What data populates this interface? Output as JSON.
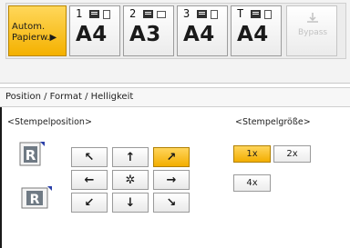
{
  "paper_select": {
    "auto_button": {
      "line1": "Autom.",
      "line2": "Papierw.▶"
    },
    "trays": [
      {
        "number": "1",
        "size": "A4"
      },
      {
        "number": "2",
        "size": "A3"
      },
      {
        "number": "3",
        "size": "A4"
      },
      {
        "number": "T",
        "size": "A4"
      }
    ],
    "bypass": {
      "label": "Bypass",
      "icon": "bypass-tray-icon"
    }
  },
  "breadcrumb": "Position / Format / Helligkeit",
  "stamp_position": {
    "label": "<Stempelposition>",
    "buttons": [
      {
        "id": "top-left",
        "glyph": "↖",
        "selected": false
      },
      {
        "id": "top-center",
        "glyph": "↑",
        "selected": false
      },
      {
        "id": "top-right",
        "glyph": "↗",
        "selected": true
      },
      {
        "id": "middle-left",
        "glyph": "←",
        "selected": false
      },
      {
        "id": "center",
        "glyph": "✲",
        "selected": false
      },
      {
        "id": "middle-right",
        "glyph": "→",
        "selected": false
      },
      {
        "id": "bottom-left",
        "glyph": "↙",
        "selected": false
      },
      {
        "id": "bottom-center",
        "glyph": "↓",
        "selected": false
      },
      {
        "id": "bottom-right",
        "glyph": "↘",
        "selected": false
      }
    ]
  },
  "stamp_size": {
    "label": "<Stempelgröße>",
    "options": [
      {
        "label": "1x",
        "selected": true
      },
      {
        "label": "2x",
        "selected": false
      },
      {
        "label": "4x",
        "selected": false
      }
    ]
  },
  "colors": {
    "selected": "#f3ae00",
    "selected_border": "#b07f00",
    "button_border": "#9a9a9a"
  }
}
